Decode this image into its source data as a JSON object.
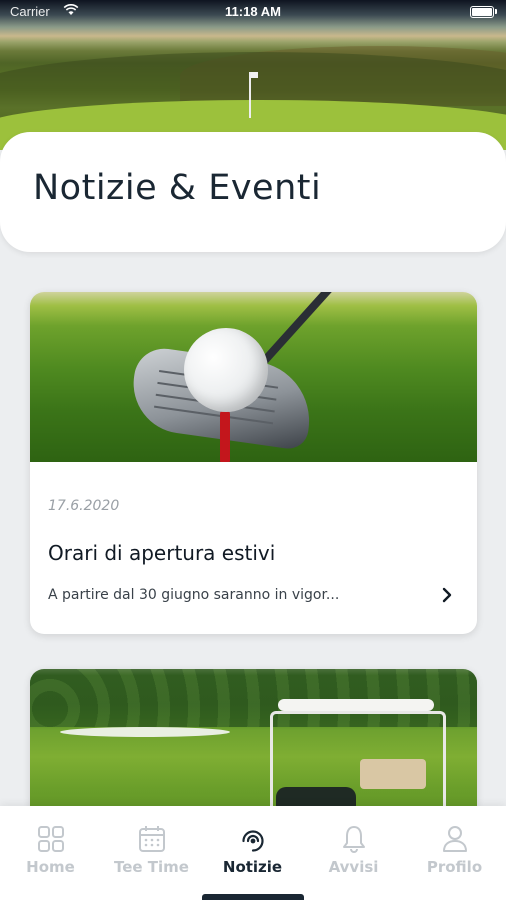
{
  "status_bar": {
    "carrier": "Carrier",
    "time": "11:18 AM"
  },
  "header": {
    "title": "Notizie & Eventi"
  },
  "news": [
    {
      "date": "17.6.2020",
      "title": "Orari di apertura estivi",
      "excerpt": "A partire dal 30 giugno saranno in vigor...",
      "image": "golf-ball-on-tee-with-driver"
    },
    {
      "image": "golf-cart-on-fairway"
    }
  ],
  "tabs": [
    {
      "label": "Home",
      "icon": "grid-icon",
      "active": false
    },
    {
      "label": "Tee Time",
      "icon": "calendar-icon",
      "active": false
    },
    {
      "label": "Notizie",
      "icon": "news-signal-icon",
      "active": true
    },
    {
      "label": "Avvisi",
      "icon": "bell-icon",
      "active": false
    },
    {
      "label": "Profilo",
      "icon": "user-icon",
      "active": false
    }
  ],
  "colors": {
    "accent": "#1a2733",
    "inactive_tab": "#c3c8cd",
    "background": "#eceef0"
  }
}
